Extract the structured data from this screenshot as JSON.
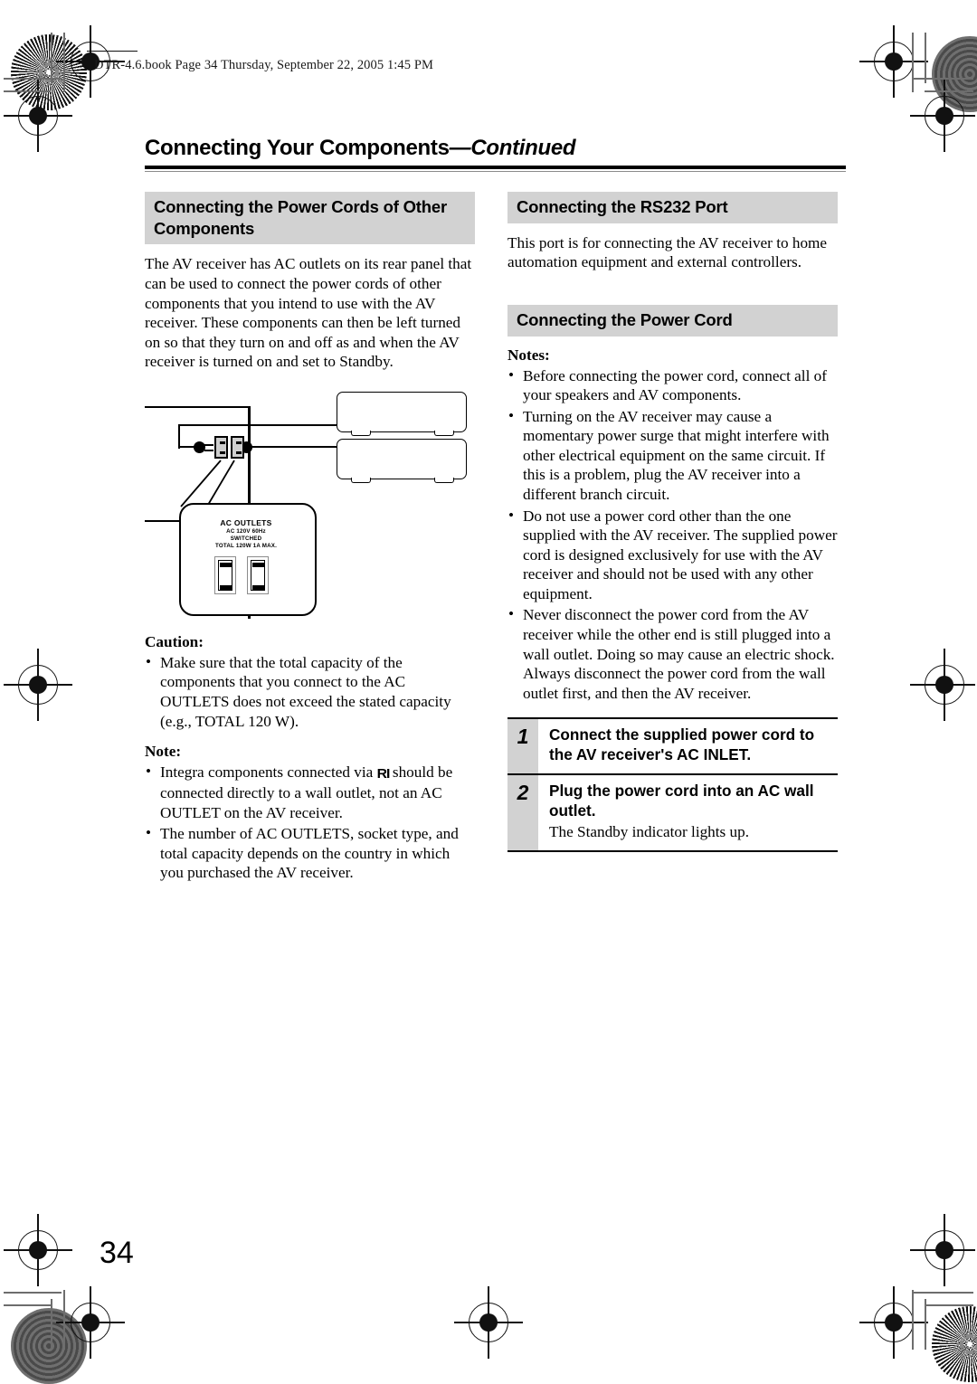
{
  "file_header": "DTR-4.6.book  Page 34  Thursday, September 22, 2005  1:45 PM",
  "page_title": {
    "main": "Connecting Your Components",
    "continued": "—Continued"
  },
  "page_number": "34",
  "colors": {
    "heading_band": "#d2d2d2",
    "rule": "#000000"
  },
  "left_column": {
    "heading": "Connecting the Power Cords of Other Components",
    "intro": "The AV receiver has AC outlets on its rear panel that can be used to connect the power cords of other components that you intend to use with the AV receiver. These components can then be left turned on so that they turn on and off as and when the AV receiver is turned on and set to Standby.",
    "diagram": {
      "outlet_label_title": "AC OUTLETS",
      "outlet_label_line1": "AC 120V  60Hz",
      "outlet_label_line2": "SWITCHED",
      "outlet_label_line3": "TOTAL  120W  1A  MAX."
    },
    "caution_label": "Caution:",
    "caution_items": [
      "Make sure that the total capacity of the components that you connect to the AC OUTLETS does not exceed the stated capacity (e.g., TOTAL 120 W)."
    ],
    "note_label": "Note:",
    "note_items_pre": "Integra components connected via ",
    "note_items_ri": "RI",
    "note_items_post": " should be connected directly to a wall outlet, not an AC OUTLET on the AV receiver.",
    "note_item2": "The number of AC OUTLETS, socket type, and total capacity depends on the country in which you purchased the AV receiver."
  },
  "right_column": {
    "rs232_heading": "Connecting the RS232 Port",
    "rs232_body": "This port is for connecting the AV receiver to home automation equipment and external controllers.",
    "power_heading": "Connecting the Power Cord",
    "notes_label": "Notes:",
    "notes": [
      "Before connecting the power cord, connect all of your speakers and AV components.",
      "Turning on the AV receiver may cause a momentary power surge that might interfere with other electrical equipment on the same circuit. If this is a problem, plug the AV receiver into a different branch circuit.",
      "Do not use a power cord other than the one supplied with the AV receiver. The supplied power cord is designed exclusively for use with the AV receiver and should not be used with any other equipment.",
      "Never disconnect the power cord from the AV receiver while the other end is still plugged into a wall outlet. Doing so may cause an electric shock. Always disconnect the power cord from the wall outlet first, and then the AV receiver."
    ],
    "steps": [
      {
        "num": "1",
        "bold": "Connect the supplied power cord to the AV receiver's AC INLET.",
        "sub": ""
      },
      {
        "num": "2",
        "bold": "Plug the power cord into an AC wall outlet.",
        "sub": "The Standby indicator lights up."
      }
    ]
  }
}
